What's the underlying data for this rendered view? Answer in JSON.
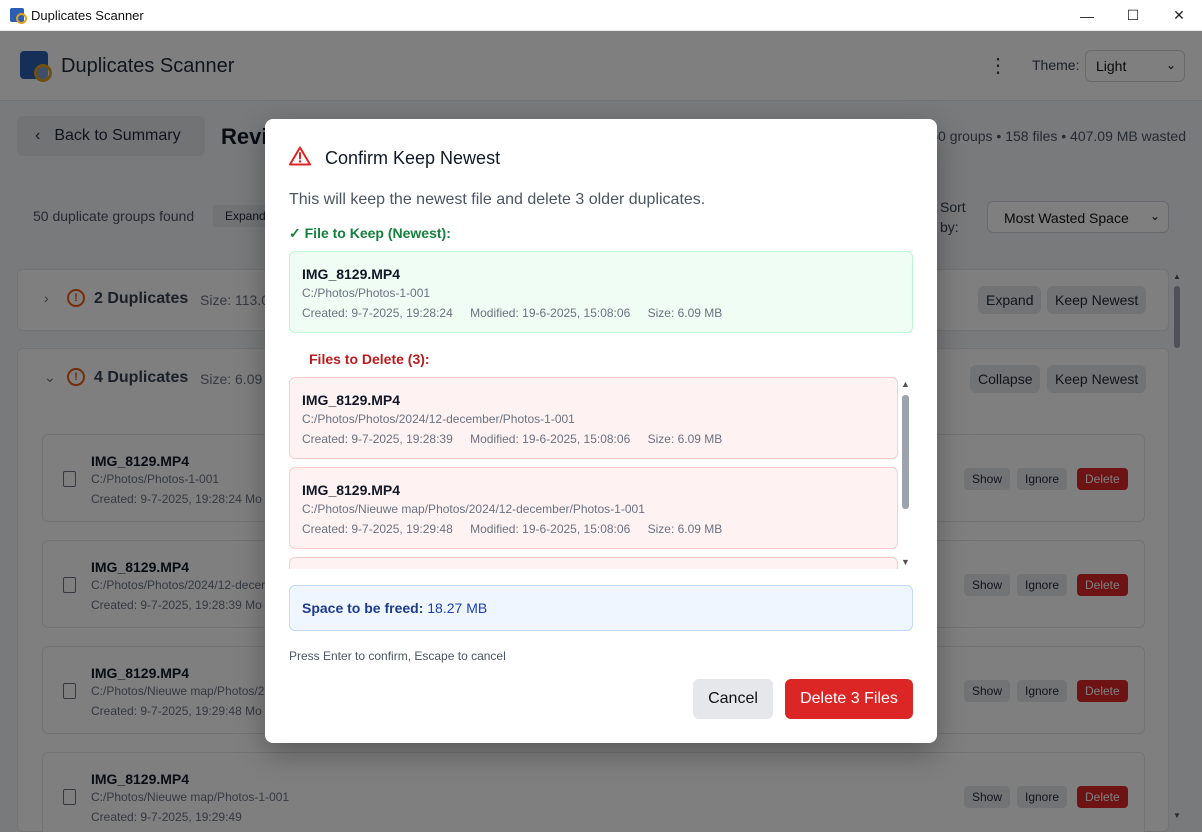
{
  "window": {
    "title": "Duplicates Scanner",
    "minimize": "—",
    "maximize": "☐",
    "close": "✕"
  },
  "header": {
    "app_title": "Duplicates Scanner",
    "theme_label": "Theme:",
    "theme_value": "Light"
  },
  "page": {
    "back_label": "Back to Summary",
    "title": "Revi",
    "summary": "50 groups • 158 files • 407.09 MB wasted",
    "groups_found": "50 duplicate groups found",
    "expand_all": "Expand",
    "sort_label": "Sort by:",
    "sort_value": "Most Wasted Space"
  },
  "groups": [
    {
      "count": "2 Duplicates",
      "size": "Size: 113.0",
      "btn1": "Expand",
      "btn2": "Keep Newest"
    },
    {
      "count": "4 Duplicates",
      "size": "Size: 6.09 M",
      "btn1": "Collapse",
      "btn2": "Keep Newest"
    }
  ],
  "files": [
    {
      "name": "IMG_8129.MP4",
      "path": "C:/Photos/Photos-1-001",
      "meta": "Created: 9-7-2025, 19:28:24    Mo"
    },
    {
      "name": "IMG_8129.MP4",
      "path": "C:/Photos/Photos/2024/12-decer",
      "meta": "Created: 9-7-2025, 19:28:39    Mo"
    },
    {
      "name": "IMG_8129.MP4",
      "path": "C:/Photos/Nieuwe map/Photos/2",
      "meta": "Created: 9-7-2025, 19:29:48    Mo"
    },
    {
      "name": "IMG_8129.MP4",
      "path": "C:/Photos/Nieuwe map/Photos-1-001",
      "meta": "Created: 9-7-2025, 19:29:49"
    }
  ],
  "file_actions": {
    "show": "Show",
    "ignore": "Ignore",
    "delete": "Delete"
  },
  "modal": {
    "title": "Confirm Keep Newest",
    "description": "This will keep the newest file and delete 3 older duplicates.",
    "keep_label": "File to Keep (Newest):",
    "keep_file": {
      "name": "IMG_8129.MP4",
      "path": "C:/Photos/Photos-1-001",
      "created": "Created: 9-7-2025, 19:28:24",
      "modified": "Modified: 19-6-2025, 15:08:06",
      "size": "Size: 6.09 MB"
    },
    "delete_label": "Files to Delete (3):",
    "delete_files": [
      {
        "name": "IMG_8129.MP4",
        "path": "C:/Photos/Photos/2024/12-december/Photos-1-001",
        "created": "Created: 9-7-2025, 19:28:39",
        "modified": "Modified: 19-6-2025, 15:08:06",
        "size": "Size: 6.09 MB"
      },
      {
        "name": "IMG_8129.MP4",
        "path": "C:/Photos/Nieuwe map/Photos/2024/12-december/Photos-1-001",
        "created": "Created: 9-7-2025, 19:29:48",
        "modified": "Modified: 19-6-2025, 15:08:06",
        "size": "Size: 6.09 MB"
      }
    ],
    "freed_label": "Space to be freed:",
    "freed_value": "18.27 MB",
    "hint": "Press Enter to confirm, Escape to cancel",
    "cancel": "Cancel",
    "confirm": "Delete 3 Files"
  }
}
